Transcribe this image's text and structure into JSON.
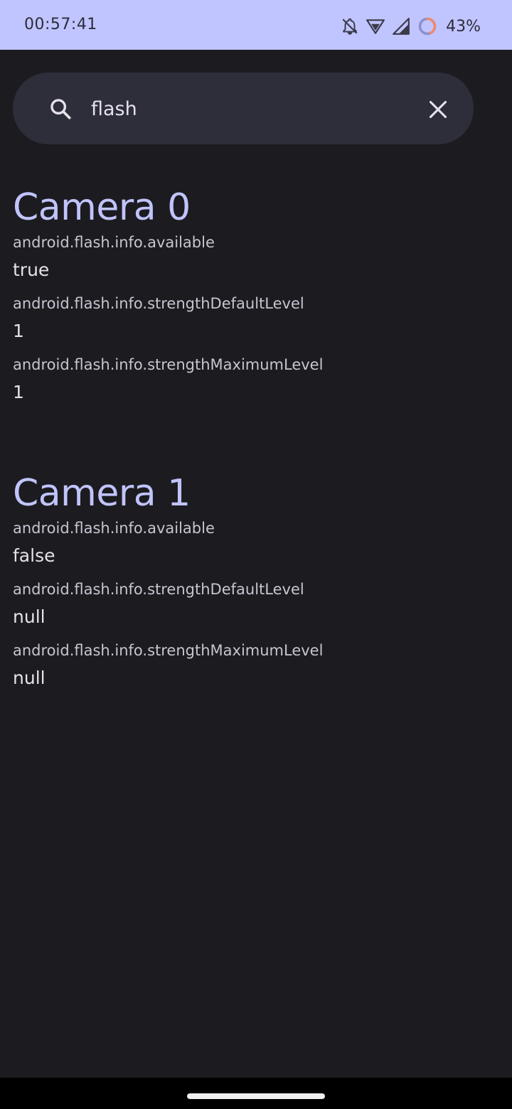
{
  "status_bar": {
    "time": "00:57:41",
    "battery_percent": "43%",
    "battery_level": 0.43,
    "icons": [
      "bell-off-icon",
      "wifi-icon",
      "cellular-signal-icon",
      "battery-ring-icon"
    ]
  },
  "search": {
    "value": "flash",
    "icons": [
      "search-icon",
      "close-icon"
    ]
  },
  "cameras": [
    {
      "title": "Camera 0",
      "properties": [
        {
          "key": "android.flash.info.available",
          "value": "true"
        },
        {
          "key": "android.flash.info.strengthDefaultLevel",
          "value": "1"
        },
        {
          "key": "android.flash.info.strengthMaximumLevel",
          "value": "1"
        }
      ]
    },
    {
      "title": "Camera 1",
      "properties": [
        {
          "key": "android.flash.info.available",
          "value": "false"
        },
        {
          "key": "android.flash.info.strengthDefaultLevel",
          "value": "null"
        },
        {
          "key": "android.flash.info.strengthMaximumLevel",
          "value": "null"
        }
      ]
    }
  ],
  "colors": {
    "status_bar_bg": "#c1c5ff",
    "background": "#1c1b20",
    "search_bg": "#2d2e3a",
    "accent": "#c0c4fb",
    "battery_ring": "#f0896a"
  }
}
